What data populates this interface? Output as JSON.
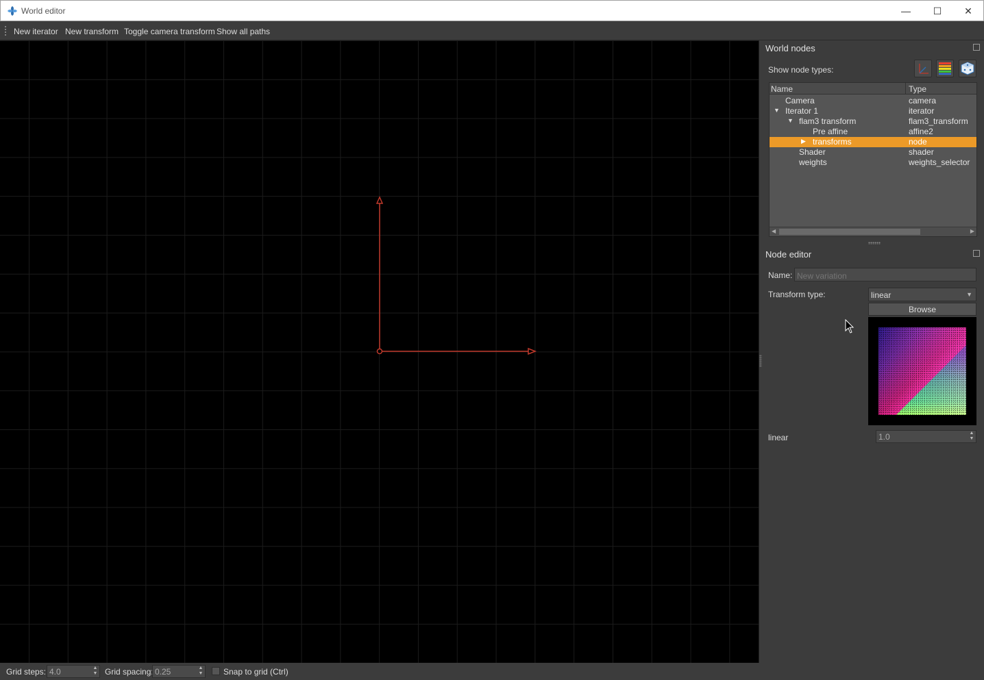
{
  "window": {
    "title": "World editor",
    "minimize": "—",
    "maximize": "☐",
    "close": "✕"
  },
  "toolbar": {
    "new_iterator": "New iterator",
    "new_transform": "New transform",
    "toggle_camera": "Toggle camera transform",
    "show_all_paths": "Show all paths"
  },
  "world_nodes": {
    "title": "World nodes",
    "show_types_label": "Show node types:",
    "columns": {
      "name": "Name",
      "type": "Type"
    },
    "rows": [
      {
        "name": "Camera",
        "type": "camera",
        "expander": ""
      },
      {
        "name": "Iterator 1",
        "type": "iterator",
        "expander": "▼"
      },
      {
        "name": "flam3 transform",
        "type": "flam3_transform",
        "expander": "▼"
      },
      {
        "name": "Pre affine",
        "type": "affine2",
        "expander": ""
      },
      {
        "name": "transforms",
        "type": "node",
        "expander": "▶",
        "selected": true
      },
      {
        "name": "Shader",
        "type": "shader",
        "expander": ""
      },
      {
        "name": "weights",
        "type": "weights_selector",
        "expander": ""
      }
    ]
  },
  "node_editor": {
    "title": "Node editor",
    "name_label": "Name:",
    "name_placeholder": "New variation",
    "transform_type_label": "Transform type:",
    "transform_type_value": "linear",
    "browse": "Browse",
    "weight_label": "linear",
    "weight_value": "1.0"
  },
  "status": {
    "grid_steps_label": "Grid steps:",
    "grid_steps_value": "4.0",
    "grid_spacing_label": "Grid spacing:",
    "grid_spacing_value": "0.25",
    "snap_label": "Snap to grid (Ctrl)",
    "snap_checked": false
  },
  "colors": {
    "selection": "#ec9a28",
    "axis": "#c0392b",
    "viewport_bg": "#000000",
    "panel_bg": "#3c3c3c"
  }
}
